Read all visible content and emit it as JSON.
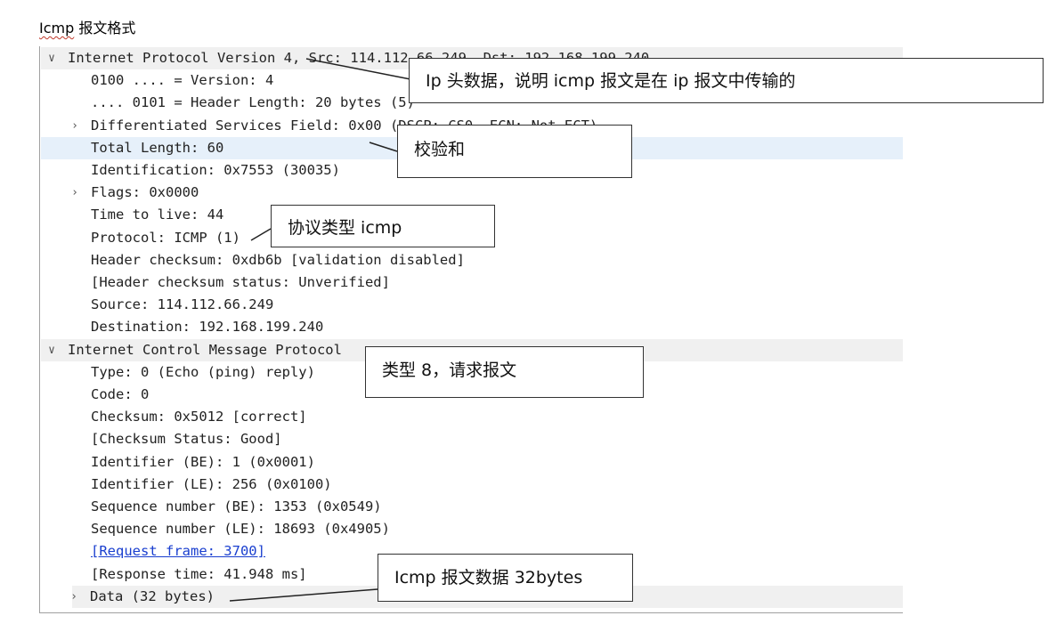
{
  "doc_title": {
    "squiggle": "Icmp",
    "rest": " 报文格式"
  },
  "rows": [
    {
      "indent": 0,
      "caret": "∨",
      "text": "Internet Protocol Version 4, Src: 114.112.66.249, Dst: 192.168.199.240",
      "section": true
    },
    {
      "indent": 1,
      "caret": "",
      "text": "0100 .... = Version: 4"
    },
    {
      "indent": 1,
      "caret": "",
      "text": ".... 0101 = Header Length: 20 bytes (5)"
    },
    {
      "indent": 1,
      "caret": "›",
      "text": "Differentiated Services Field: 0x00 (DSCP: CS0, ECN: Not-ECT)"
    },
    {
      "indent": 1,
      "caret": "",
      "text": "Total Length: 60",
      "highlight": true
    },
    {
      "indent": 1,
      "caret": "",
      "text": "Identification: 0x7553 (30035)"
    },
    {
      "indent": 1,
      "caret": "›",
      "text": "Flags: 0x0000"
    },
    {
      "indent": 1,
      "caret": "",
      "text": "Time to live: 44"
    },
    {
      "indent": 1,
      "caret": "",
      "text": "Protocol: ICMP (1)"
    },
    {
      "indent": 1,
      "caret": "",
      "text": "Header checksum: 0xdb6b [validation disabled]"
    },
    {
      "indent": 1,
      "caret": "",
      "text": "[Header checksum status: Unverified]"
    },
    {
      "indent": 1,
      "caret": "",
      "text": "Source: 114.112.66.249"
    },
    {
      "indent": 1,
      "caret": "",
      "text": "Destination: 192.168.199.240"
    },
    {
      "indent": 0,
      "caret": "∨",
      "text": "Internet Control Message Protocol",
      "section": true
    },
    {
      "indent": 1,
      "caret": "",
      "text": "Type: 0 (Echo (ping) reply)"
    },
    {
      "indent": 1,
      "caret": "",
      "text": "Code: 0"
    },
    {
      "indent": 1,
      "caret": "",
      "text": "Checksum: 0x5012 [correct]"
    },
    {
      "indent": 1,
      "caret": "",
      "text": "[Checksum Status: Good]"
    },
    {
      "indent": 1,
      "caret": "",
      "text": "Identifier (BE): 1 (0x0001)"
    },
    {
      "indent": 1,
      "caret": "",
      "text": "Identifier (LE): 256 (0x0100)"
    },
    {
      "indent": 1,
      "caret": "",
      "text": "Sequence number (BE): 1353 (0x0549)"
    },
    {
      "indent": 1,
      "caret": "",
      "text": "Sequence number (LE): 18693 (0x4905)"
    },
    {
      "indent": 1,
      "caret": "",
      "text": "[Request frame: 3700]",
      "link": true
    },
    {
      "indent": 1,
      "caret": "",
      "text": "[Response time: 41.948 ms]"
    },
    {
      "indent": 1,
      "caret": "›",
      "text": "Data (32 bytes)",
      "section": true
    }
  ],
  "callouts": {
    "ip_header": "Ip 头数据，说明 icmp 报文是在 ip 报文中传输的",
    "checksum": "校验和",
    "protocol": "协议类型 icmp",
    "type": "类型 8，请求报文",
    "data": "Icmp 报文数据 32bytes"
  }
}
